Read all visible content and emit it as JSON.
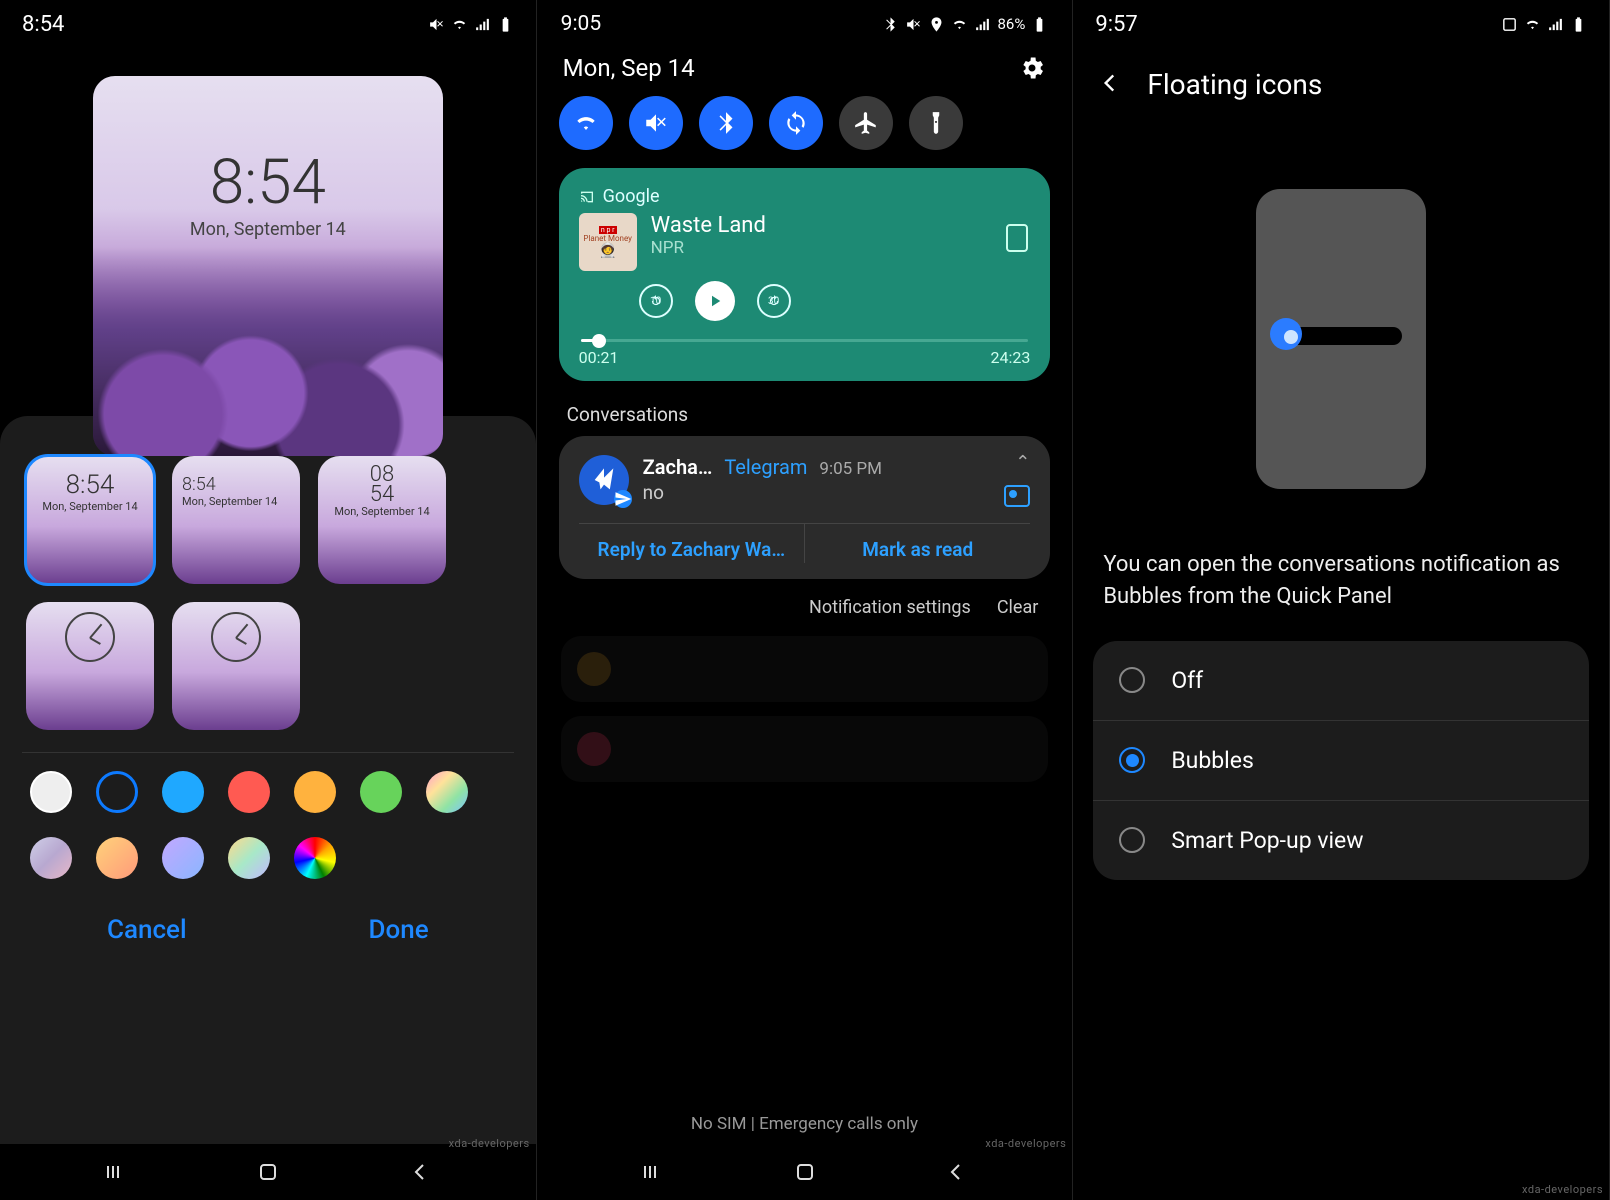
{
  "phone1": {
    "status": {
      "time": "8:54"
    },
    "preview": {
      "time": "8:54",
      "date": "Mon, September 14"
    },
    "thumbs": [
      {
        "time": "8:54",
        "date": "Mon, September 14",
        "selected": true,
        "style": "digital-center"
      },
      {
        "time": "8:54",
        "date": "Mon, September 14",
        "selected": false,
        "style": "digital-left"
      },
      {
        "time": "08 54",
        "date": "Mon, September 14",
        "selected": false,
        "style": "digital-stack"
      },
      {
        "style": "analog",
        "selected": false
      },
      {
        "style": "analog",
        "selected": false
      }
    ],
    "colors": {
      "row1": [
        "#eeeeee",
        "ring",
        "#1fa8ff",
        "#ff5a52",
        "#ffb23e",
        "#67d35b"
      ],
      "row2": [
        "linear-gradient(135deg,#ff9ecb,#ffe29a,#8fe3a4,#7cc2ff)",
        "linear-gradient(135deg,#cfcfe8,#b8a8d0,#e8b8c8)",
        "linear-gradient(135deg,#ffd27a,#ff9a7a)",
        "linear-gradient(135deg,#c2a8ff,#8ab6ff)",
        "linear-gradient(135deg,#ffd98a,#a8e8c8,#c2b8ff)",
        "conic-gradient(red,orange,yellow,green,cyan,blue,magenta,red)"
      ]
    },
    "buttons": {
      "cancel": "Cancel",
      "done": "Done"
    }
  },
  "phone2": {
    "status": {
      "time": "9:05",
      "battery": "86%"
    },
    "date": "Mon, Sep 14",
    "tiles": [
      {
        "name": "wifi",
        "on": true
      },
      {
        "name": "mute",
        "on": true
      },
      {
        "name": "bluetooth",
        "on": true
      },
      {
        "name": "rotate",
        "on": true
      },
      {
        "name": "airplane",
        "on": false
      },
      {
        "name": "flashlight",
        "on": false
      }
    ],
    "media": {
      "source": "Google",
      "art_label": "Planet Money",
      "title": "Waste Land",
      "artist": "NPR",
      "elapsed": "00:21",
      "duration": "24:23",
      "rewind": "10",
      "forward": "30"
    },
    "conversations_label": "Conversations",
    "conversation": {
      "name": "Zacha…",
      "app": "Telegram",
      "time": "9:05 PM",
      "message": "no",
      "reply": "Reply to Zachary Wa…",
      "mark_read": "Mark as read"
    },
    "links": {
      "settings": "Notification settings",
      "clear": "Clear"
    },
    "footer": "No SIM | Emergency calls only"
  },
  "phone3": {
    "status": {
      "time": "9:57"
    },
    "title": "Floating icons",
    "hint": "You can open the conversations notification as Bubbles from the Quick Panel",
    "options": [
      {
        "label": "Off",
        "selected": false
      },
      {
        "label": "Bubbles",
        "selected": true
      },
      {
        "label": "Smart Pop-up view",
        "selected": false
      }
    ]
  },
  "watermark": "xda-developers"
}
